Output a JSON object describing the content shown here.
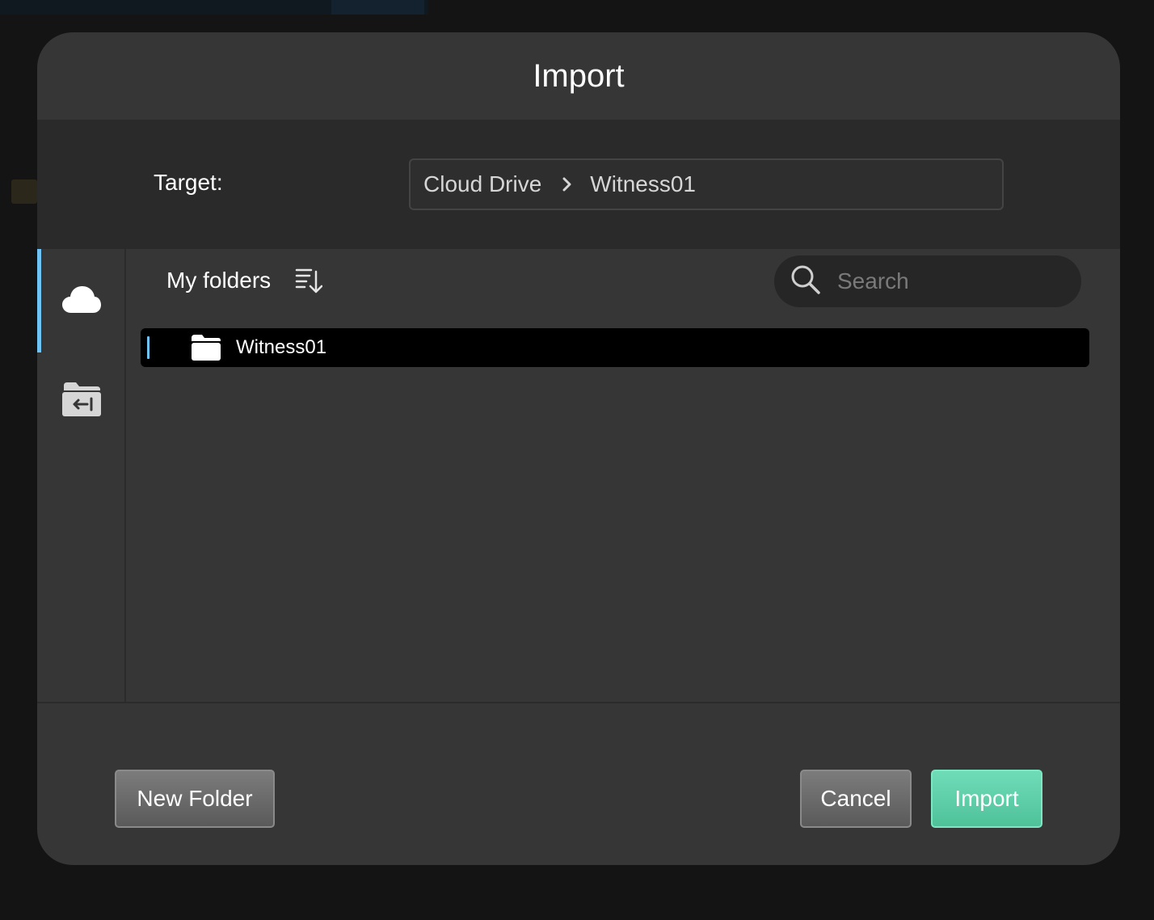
{
  "dialog": {
    "title": "Import"
  },
  "target": {
    "label": "Target:",
    "path": [
      "Cloud Drive",
      "Witness01"
    ]
  },
  "sidebar": {
    "items": [
      {
        "icon": "cloud-icon",
        "active": true
      },
      {
        "icon": "import-folder-icon",
        "active": false
      }
    ]
  },
  "list": {
    "title": "My folders",
    "sort_icon": "sort-descending-icon",
    "search": {
      "placeholder": "Search",
      "value": ""
    },
    "folders": [
      {
        "name": "Witness01",
        "selected": true
      }
    ]
  },
  "footer": {
    "new_folder_label": "New Folder",
    "cancel_label": "Cancel",
    "import_label": "Import"
  },
  "colors": {
    "accent_blue": "#6fc3f5",
    "import_green": "#5fd0aa",
    "dialog_bg": "#363636"
  }
}
